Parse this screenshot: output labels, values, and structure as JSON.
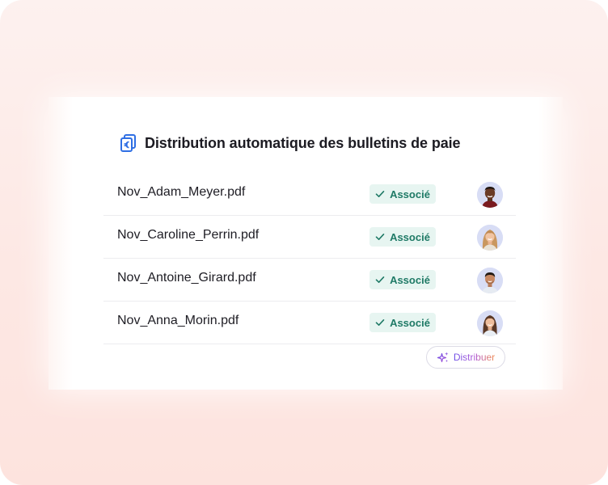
{
  "header": {
    "title": "Distribution automatique des bulletins de paie",
    "icon": "document-euro-icon"
  },
  "rows": [
    {
      "file": "Nov_Adam_Meyer.pdf",
      "status": "Associé",
      "avatar": "avatar-adam-meyer"
    },
    {
      "file": "Nov_Caroline_Perrin.pdf",
      "status": "Associé",
      "avatar": "avatar-caroline-perrin"
    },
    {
      "file": "Nov_Antoine_Girard.pdf",
      "status": "Associé",
      "avatar": "avatar-antoine-girard"
    },
    {
      "file": "Nov_Anna_Morin.pdf",
      "status": "Associé",
      "avatar": "avatar-anna-morin"
    }
  ],
  "action": {
    "label": "Distribuer",
    "icon": "sparkle-icon"
  },
  "colors": {
    "accent_blue": "#2f6fe4",
    "status_green": "#1f7a66",
    "status_bg": "#e7f5f1",
    "background": "#fde8e4"
  }
}
